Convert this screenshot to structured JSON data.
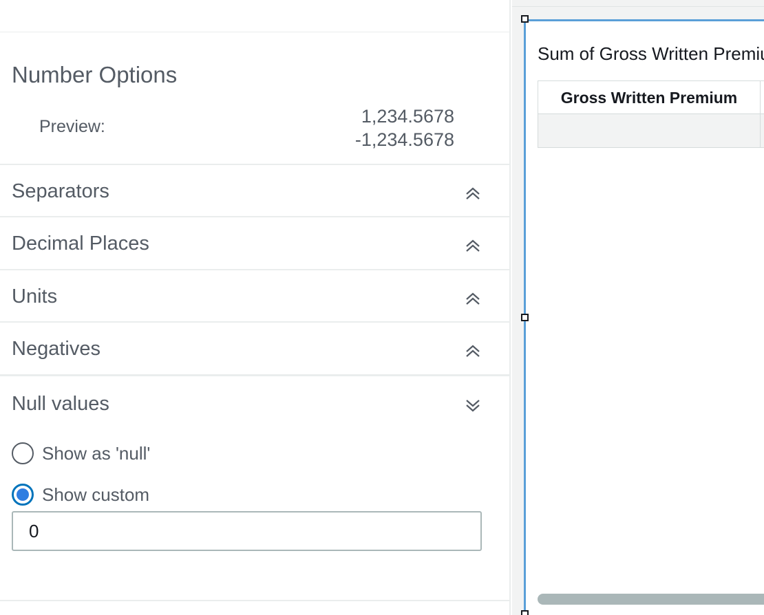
{
  "panel": {
    "title": "Number Options",
    "preview_label": "Preview:",
    "preview_values": [
      "1,234.5678",
      "-1,234.5678"
    ]
  },
  "sections": [
    {
      "label": "Separators",
      "state": "collapsed",
      "icon": "double-chevron-up-icon"
    },
    {
      "label": "Decimal Places",
      "state": "collapsed",
      "icon": "double-chevron-up-icon"
    },
    {
      "label": "Units",
      "state": "collapsed",
      "icon": "double-chevron-up-icon"
    },
    {
      "label": "Negatives",
      "state": "collapsed",
      "icon": "double-chevron-up-icon"
    },
    {
      "label": "Null values",
      "state": "expanded",
      "icon": "double-chevron-down-icon"
    }
  ],
  "null_values": {
    "options": [
      {
        "label": "Show as 'null'",
        "checked": false
      },
      {
        "label": "Show custom",
        "checked": true
      }
    ],
    "custom_value": "0"
  },
  "visual": {
    "title": "Sum of Gross Written Premium",
    "column_header": "Gross Written Premium",
    "row_value": ""
  },
  "colors": {
    "accent": "#0073bb",
    "radio_fill": "#2f7de1",
    "selection_border": "#5a9fd8",
    "text": "#545b64",
    "divider": "#eaeded"
  }
}
